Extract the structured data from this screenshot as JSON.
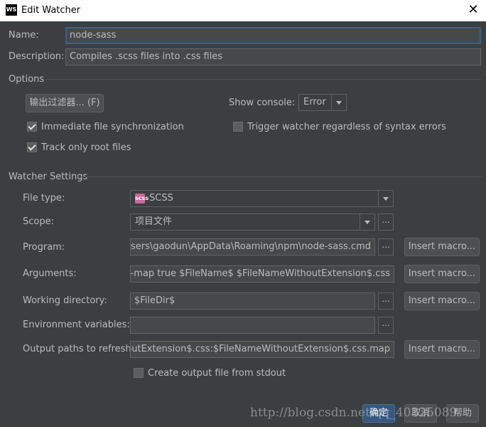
{
  "window": {
    "title": "Edit Watcher",
    "app_icon_text": "WS"
  },
  "name": {
    "label": "Name:",
    "value": "node-sass"
  },
  "description": {
    "label": "Description:",
    "value": "Compiles .scss files into .css files"
  },
  "options": {
    "header": "Options",
    "output_filters_button": "输出过滤器... (F)",
    "show_console_label": "Show console:",
    "show_console_value": "Error",
    "immediate_sync": {
      "label": "Immediate file synchronization",
      "checked": true
    },
    "trigger_watcher": {
      "label": "Trigger watcher regardless of syntax errors",
      "checked": false
    },
    "track_root": {
      "label": "Track only root files",
      "checked": true
    }
  },
  "watcher_settings": {
    "header": "Watcher Settings",
    "file_type": {
      "label": "File type:",
      "value": "SCSS",
      "icon_text": "scss"
    },
    "scope": {
      "label": "Scope:",
      "value": "项目文件"
    },
    "program": {
      "label": "Program:",
      "value": "C:\\Users\\gaodun\\AppData\\Roaming\\npm\\node-sass.cmd"
    },
    "arguments": {
      "label": "Arguments:",
      "value": "--source-map true $FileName$ $FileNameWithoutExtension$.css"
    },
    "working_directory": {
      "label": "Working directory:",
      "value": "$FileDir$"
    },
    "environment_variables": {
      "label": "Environment variables:",
      "value": ""
    },
    "output_paths": {
      "label": "Output paths to refresh:",
      "value": "$FileNameWithoutExtension$.css:$FileNameWithoutExtension$.css.map"
    },
    "insert_macro_label": "Insert macro...",
    "browse_label": "...",
    "create_output": {
      "label": "Create output file from stdout",
      "checked": false
    }
  },
  "footer": {
    "ok": "确定",
    "cancel": "取消",
    "help": "帮助"
  },
  "watermark": "http://blog.csdn.net/qq_40325089"
}
